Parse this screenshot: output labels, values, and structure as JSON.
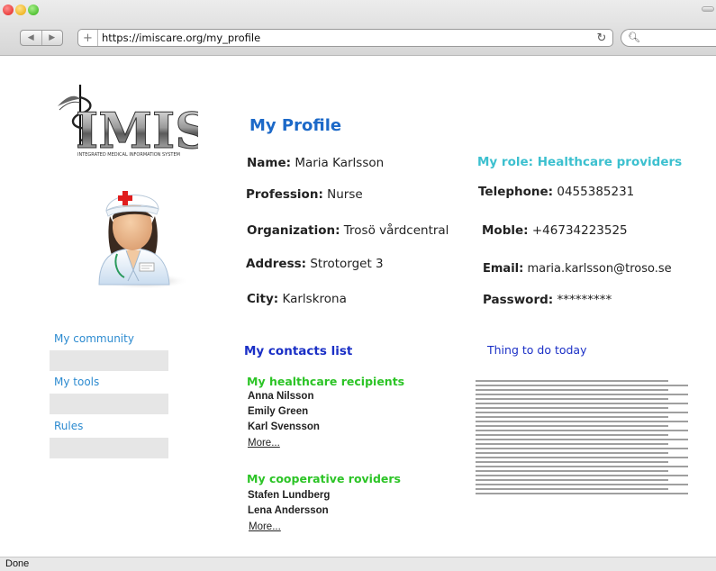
{
  "browser": {
    "url": "https://imiscare.org/my_profile",
    "url_plus": "+",
    "reload_glyph": "↻",
    "search_glyph": "🔍︎",
    "back_glyph": "◀",
    "forward_glyph": "▶",
    "status": "Done"
  },
  "logo": {
    "text": "IMIS",
    "tagline": "INTEGRATED MEDICAL INFORMATION SYSTEM"
  },
  "sidebar": {
    "items": [
      {
        "label": "My community"
      },
      {
        "label": "My tools"
      },
      {
        "label": "Rules"
      }
    ]
  },
  "profile": {
    "title": "My Profile",
    "name_label": "Name:",
    "name": "Maria Karlsson",
    "profession_label": "Profession:",
    "profession": "Nurse",
    "organization_label": "Organization:",
    "organization": "Trosö vårdcentral",
    "address_label": "Address:",
    "address": "Strotorget 3",
    "city_label": "City:",
    "city": "Karlskrona",
    "role": "My role: Healthcare providers",
    "telephone_label": "Telephone:",
    "telephone": "0455385231",
    "mobile_label": "Moble:",
    "mobile": "+46734223525",
    "email_label": "Email:",
    "email": "maria.karlsson@troso.se",
    "password_label": "Password:",
    "password": "*********"
  },
  "contacts": {
    "title": "My contacts list",
    "recipients_title": "My healthcare recipients",
    "recipients": [
      "Anna Nilsson",
      "Emily Green",
      "Karl Svensson"
    ],
    "recipients_more": "More...",
    "providers_title": "My cooperative roviders",
    "providers": [
      "Stafen Lundberg",
      "Lena Andersson"
    ],
    "providers_more": "More..."
  },
  "todo": {
    "title": "Thing to do today"
  },
  "colors": {
    "title_blue": "#1c69c8",
    "role_teal": "#3cc0cf",
    "section_blue": "#1a2fc6",
    "group_green": "#2cc426",
    "nav_link": "#2d8bd0"
  }
}
